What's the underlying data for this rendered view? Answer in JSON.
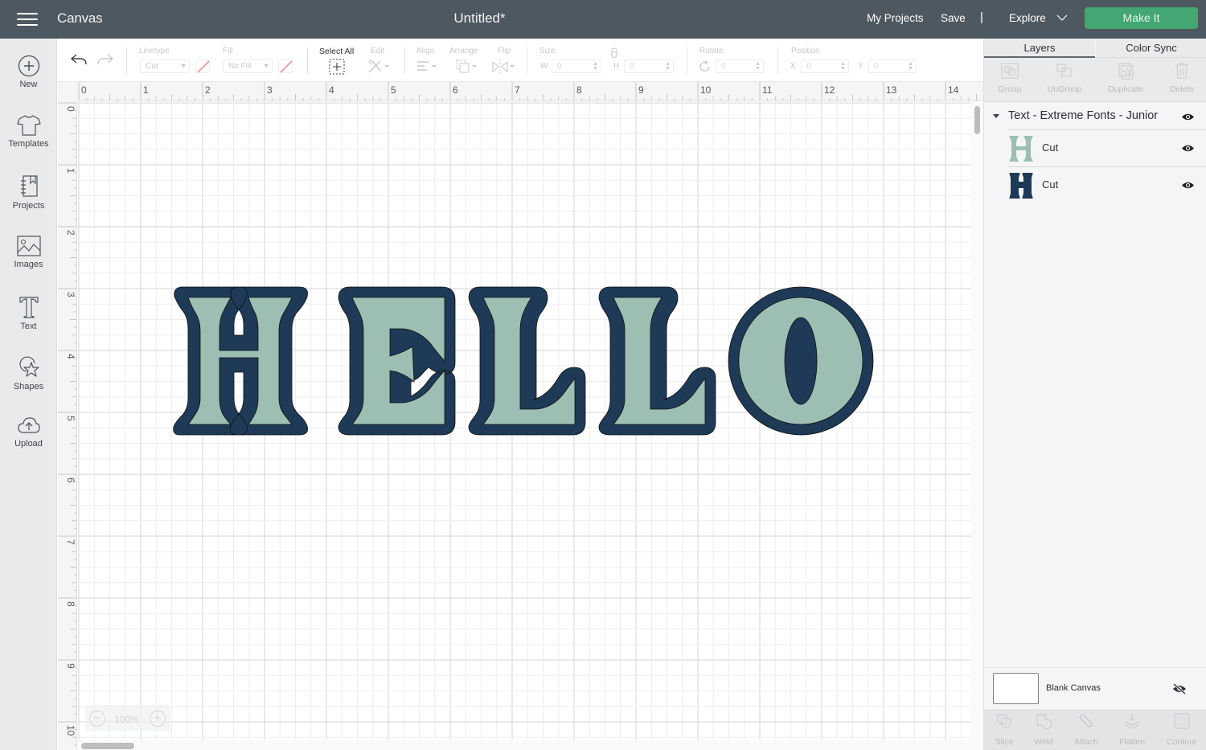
{
  "header": {
    "app_title": "Canvas",
    "document_title": "Untitled*",
    "links": {
      "my_projects": "My Projects",
      "save": "Save",
      "separator": "|",
      "explore": "Explore"
    },
    "make_it": "Make It",
    "colors": {
      "bar": "#4e5860",
      "make_it": "#44a672"
    }
  },
  "sidebar": {
    "items": [
      {
        "label": "New",
        "icon": "plus-circle-icon"
      },
      {
        "label": "Templates",
        "icon": "tshirt-icon"
      },
      {
        "label": "Projects",
        "icon": "notebook-icon"
      },
      {
        "label": "Images",
        "icon": "image-icon"
      },
      {
        "label": "Text",
        "icon": "text-t-icon"
      },
      {
        "label": "Shapes",
        "icon": "shapes-icon"
      },
      {
        "label": "Upload",
        "icon": "cloud-upload-icon"
      }
    ]
  },
  "toolbar": {
    "linetype": {
      "label": "Linetype",
      "value": "Cut"
    },
    "fill": {
      "label": "Fill",
      "value": "No Fill"
    },
    "select_all": "Select All",
    "edit": "Edit",
    "align": "Align",
    "arrange": "Arrange",
    "flip": "Flip",
    "size": {
      "label": "Size",
      "w_label": "W",
      "w_value": "0",
      "h_label": "H",
      "h_value": "0"
    },
    "rotate": {
      "label": "Rotate",
      "value": "0"
    },
    "position": {
      "label": "Position",
      "x_label": "X",
      "x_value": "0",
      "y_label": "Y",
      "y_value": "0"
    }
  },
  "rulers": {
    "horizontal": [
      "0",
      "1",
      "2",
      "3",
      "4",
      "5",
      "6",
      "7",
      "8",
      "9",
      "10",
      "11",
      "12",
      "13",
      "14"
    ],
    "vertical": [
      "0",
      "1",
      "2",
      "3",
      "4",
      "5",
      "6",
      "7",
      "8",
      "9",
      "10"
    ]
  },
  "canvas": {
    "text": "HELLO",
    "fill_color": "#9dbfb3",
    "outline_color": "#1e3a56",
    "zoom": "100%"
  },
  "layers_panel": {
    "tabs": [
      "Layers",
      "Color Sync"
    ],
    "active_tab": "Layers",
    "actions": [
      "Group",
      "UnGroup",
      "Duplicate",
      "Delete"
    ],
    "group": {
      "name": "Text - Extreme Fonts - Junior",
      "layers": [
        {
          "name": "Cut",
          "color": "#9dbfb3"
        },
        {
          "name": "Cut",
          "color": "#1e3a56"
        }
      ]
    },
    "blank_canvas": "Blank Canvas",
    "bottom_actions": [
      "Slice",
      "Weld",
      "Attach",
      "Flatten",
      "Contour"
    ]
  }
}
